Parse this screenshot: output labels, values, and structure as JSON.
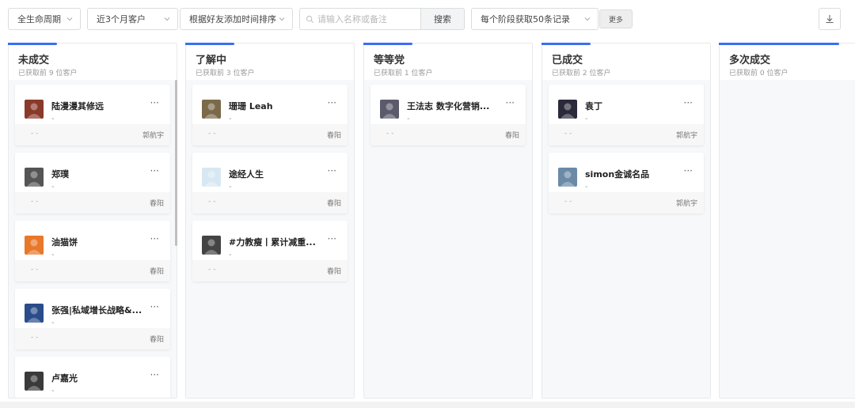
{
  "toolbar": {
    "lifecycle": "全生命周期",
    "period": "近3个月客户",
    "sort": "根据好友添加时间排序",
    "search_placeholder": "请输入名称或备注",
    "search_button": "搜索",
    "per_stage": "每个阶段获取50条记录",
    "more_button": "更多"
  },
  "columns": [
    {
      "title": "未成交",
      "subtitle": "已获取前 9 位客户",
      "cards": [
        {
          "name": "陆漫漫其修远",
          "remark": "-",
          "left": "- -",
          "owner": "郭航宇",
          "avatar": "#8a3a2a"
        },
        {
          "name": "郑璞",
          "remark": "-",
          "left": "- -",
          "owner": "春阳",
          "avatar": "#555555"
        },
        {
          "name": "油猫饼",
          "remark": "-",
          "left": "- -",
          "owner": "春阳",
          "avatar": "#e8782a"
        },
        {
          "name": "张强|私域增长战略&...",
          "remark": "-",
          "left": "- -",
          "owner": "春阳",
          "avatar": "#2a4d8a"
        },
        {
          "name": "卢嘉光",
          "remark": "-",
          "left": "",
          "owner": "",
          "avatar": "#3a3a3a"
        }
      ]
    },
    {
      "title": "了解中",
      "subtitle": "已获取前 3 位客户",
      "cards": [
        {
          "name": "珊珊 Leah",
          "remark": "-",
          "left": "- -",
          "owner": "春阳",
          "avatar": "#7a6a4a"
        },
        {
          "name": "途经人生",
          "remark": "-",
          "left": "- -",
          "owner": "春阳",
          "avatar": "#d8e8f2"
        },
        {
          "name": "#力教瘦丨累计减重...",
          "remark": "-",
          "left": "- -",
          "owner": "春阳",
          "avatar": "#444444"
        }
      ]
    },
    {
      "title": "等等党",
      "subtitle": "已获取前 1 位客户",
      "cards": [
        {
          "name": "王法志 数字化营销...",
          "remark": "-",
          "left": "- -",
          "owner": "春阳",
          "avatar": "#5a5a6a"
        }
      ]
    },
    {
      "title": "已成交",
      "subtitle": "已获取前 2 位客户",
      "cards": [
        {
          "name": "袁丁",
          "remark": "-",
          "left": "- -",
          "owner": "郭航宇",
          "avatar": "#2a2a3a"
        },
        {
          "name": "simon金诚名品",
          "remark": "-",
          "left": "- -",
          "owner": "郭航宇",
          "avatar": "#6a8aa8"
        }
      ]
    },
    {
      "title": "多次成交",
      "subtitle": "已获取前 0 位客户",
      "cards": []
    }
  ],
  "colors": {
    "accent": "#3b6cf6"
  },
  "icons": [
    "chevron-down-icon",
    "search-icon",
    "more-icon",
    "download-icon"
  ],
  "card_more": "···"
}
